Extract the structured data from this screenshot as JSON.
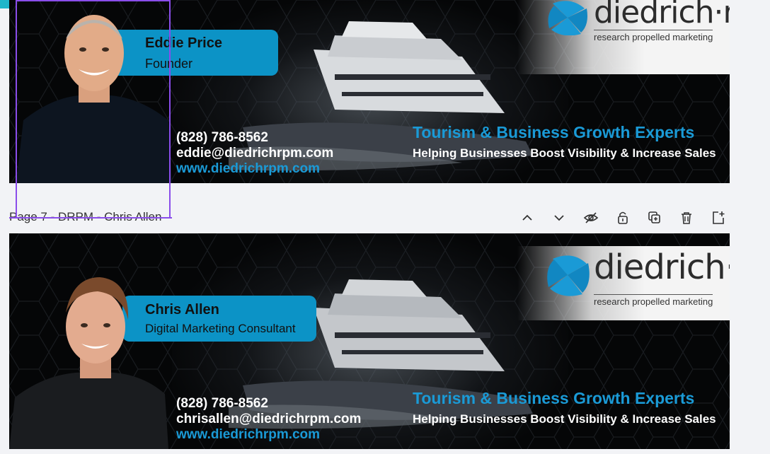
{
  "pages": [
    {
      "name": "Eddie Price",
      "role": "Founder",
      "phone": "(828) 786-8562",
      "email": "eddie@diedrichrpm.com",
      "website": "www.diedrichrpm.com",
      "headline": "Tourism & Business Growth Experts",
      "subline": "Helping Businesses Boost Visibility & Increase Sales"
    },
    {
      "name": "Chris Allen",
      "role": "Digital Marketing Consultant",
      "phone": "(828) 786-8562",
      "email": "chrisallen@diedrichrpm.com",
      "website": "www.diedrichrpm.com",
      "headline": "Tourism & Business Growth Experts",
      "subline": "Helping Businesses Boost Visibility & Increase Sales"
    }
  ],
  "logo": {
    "word": "diedrich·rpm",
    "tagline": "research propelled marketing"
  },
  "page_bar": {
    "title": "Page 7 - DRPM - Chris Allen"
  },
  "colors": {
    "accent": "#0c93c6",
    "link": "#1a9ad6",
    "selection": "#8a4dea"
  },
  "icons": [
    "chevron-up-icon",
    "chevron-down-icon",
    "hide-icon",
    "lock-icon",
    "duplicate-icon",
    "trash-icon",
    "add-page-icon"
  ]
}
